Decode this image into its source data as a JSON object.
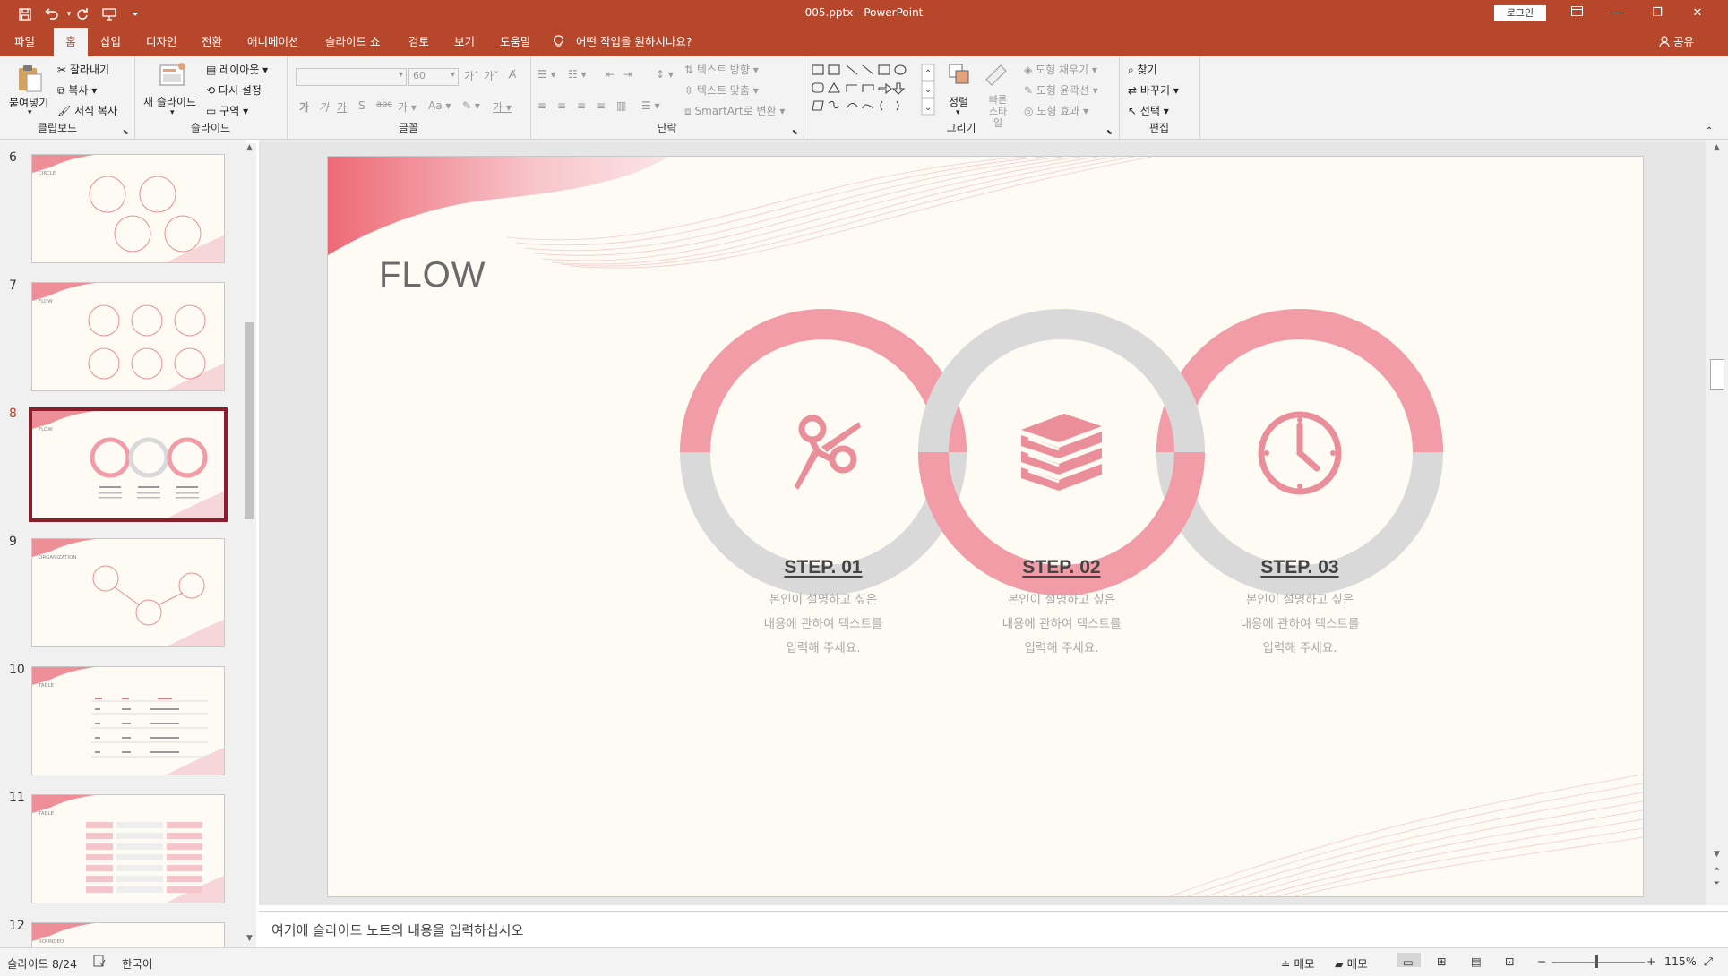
{
  "window": {
    "document_title": "005.pptx  -  PowerPoint",
    "login_label": "로그인",
    "accent_color": "#b7472a"
  },
  "quick_access": [
    "save-icon",
    "undo-icon",
    "redo-icon",
    "presentation-icon",
    "customize-icon"
  ],
  "menu": {
    "tabs": [
      "파일",
      "홈",
      "삽입",
      "디자인",
      "전환",
      "애니메이션",
      "슬라이드 쇼",
      "검토",
      "보기",
      "도움말"
    ],
    "active_tab": "홈",
    "tell_me": "어떤 작업을 원하시나요?",
    "share": "공유"
  },
  "ribbon": {
    "clipboard": {
      "label": "클립보드",
      "paste": "붙여넣기",
      "cut": "잘라내기",
      "copy": "복사",
      "format_painter": "서식 복사"
    },
    "slides": {
      "label": "슬라이드",
      "new_slide": "새 슬라이드",
      "layout": "레이아웃",
      "reset": "다시 설정",
      "section": "구역"
    },
    "font": {
      "label": "글꼴",
      "size": "60"
    },
    "paragraph": {
      "label": "단락",
      "text_direction": "텍스트 방향",
      "align_text": "텍스트 맞춤",
      "smartart": "SmartArt로 변환"
    },
    "drawing": {
      "label": "그리기",
      "arrange": "정렬",
      "quick_styles": "빠른 스타일",
      "shape_fill": "도형 채우기",
      "shape_outline": "도형 윤곽선",
      "shape_effects": "도형 효과"
    },
    "editing": {
      "label": "편집",
      "find": "찾기",
      "replace": "바꾸기",
      "select": "선택"
    }
  },
  "thumbnails": [
    {
      "num": "6",
      "label": "CIRCLE"
    },
    {
      "num": "7",
      "label": "FLOW"
    },
    {
      "num": "8",
      "label": "FLOW",
      "selected": true
    },
    {
      "num": "9",
      "label": "ORGANIZATION"
    },
    {
      "num": "10",
      "label": "TABLE"
    },
    {
      "num": "11",
      "label": "TABLE"
    },
    {
      "num": "12",
      "label": "ROUNDED"
    }
  ],
  "slide": {
    "title": "FLOW",
    "colors": {
      "pink": "#f19ca6",
      "gray": "#d9d9d9",
      "icon": "#ea8f99",
      "wave": "#ee6a76"
    },
    "steps": [
      {
        "title": "STEP. 01",
        "icon": "scissors-icon",
        "lines": [
          "본인이 설명하고 싶은",
          "내용에 관하여 텍스트를",
          "입력해 주세요."
        ]
      },
      {
        "title": "STEP. 02",
        "icon": "books-icon",
        "lines": [
          "본인이 설명하고 싶은",
          "내용에 관하여 텍스트를",
          "입력해 주세요."
        ]
      },
      {
        "title": "STEP. 03",
        "icon": "clock-icon",
        "lines": [
          "본인이 설명하고 싶은",
          "내용에 관하여 텍스트를",
          "입력해 주세요."
        ]
      }
    ]
  },
  "notes_placeholder": "여기에 슬라이드 노트의 내용을 입력하십시오",
  "status": {
    "slide_info": "슬라이드 8/24",
    "language": "한국어",
    "notes1": "메모",
    "notes2": "메모",
    "zoom": "115%"
  }
}
